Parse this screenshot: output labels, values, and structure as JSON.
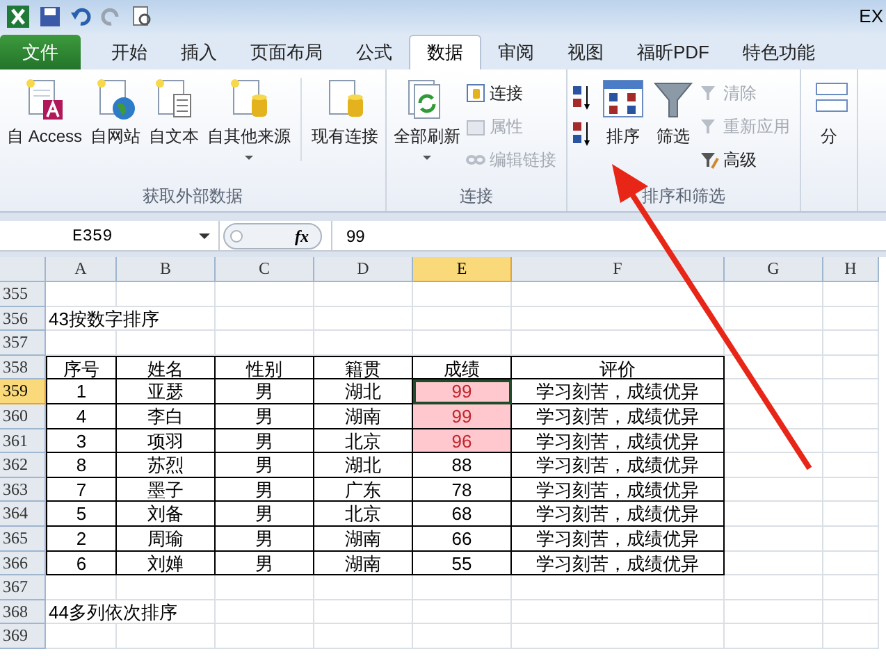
{
  "window": {
    "title": "EX"
  },
  "quick_access": [
    {
      "kind": "save"
    },
    {
      "kind": "undo"
    },
    {
      "kind": "redo"
    },
    {
      "kind": "preview"
    }
  ],
  "tabs": [
    {
      "label": "文件",
      "kind": "file",
      "selected": false
    },
    {
      "label": "开始",
      "kind": "tab",
      "selected": false
    },
    {
      "label": "插入",
      "kind": "tab",
      "selected": false
    },
    {
      "label": "页面布局",
      "kind": "tab",
      "selected": false
    },
    {
      "label": "公式",
      "kind": "tab",
      "selected": false
    },
    {
      "label": "数据",
      "kind": "tab",
      "selected": true
    },
    {
      "label": "审阅",
      "kind": "tab",
      "selected": false
    },
    {
      "label": "视图",
      "kind": "tab",
      "selected": false
    },
    {
      "label": "福昕PDF",
      "kind": "tab",
      "selected": false
    },
    {
      "label": "特色功能",
      "kind": "tab",
      "selected": false
    }
  ],
  "ribbon_groups": [
    {
      "label": "获取外部数据",
      "large": [
        {
          "label": "自 Access",
          "kind": "access",
          "dropdown": false
        },
        {
          "label": "自网站",
          "kind": "web",
          "dropdown": false
        },
        {
          "label": "自文本",
          "kind": "text",
          "dropdown": false
        },
        {
          "label": "自其他来源",
          "kind": "db",
          "dropdown": true
        },
        {
          "label": "现有连接",
          "kind": "existing",
          "dropdown": false
        }
      ]
    },
    {
      "label": "连接",
      "large": [
        {
          "label": "全部刷新",
          "kind": "refresh",
          "dropdown": true
        }
      ],
      "small": [
        {
          "label": "连接",
          "disabled": false
        },
        {
          "label": "属性",
          "disabled": true
        },
        {
          "label": "编辑链接",
          "disabled": true
        }
      ]
    },
    {
      "label": "排序和筛选",
      "large": [
        {
          "label": "排序",
          "kind": "sort",
          "dropdown": false
        },
        {
          "label": "筛选",
          "kind": "filter",
          "dropdown": false
        }
      ],
      "small": [
        {
          "label": "清除",
          "disabled": true
        },
        {
          "label": "重新应用",
          "disabled": true
        },
        {
          "label": "高级",
          "disabled": false
        }
      ]
    },
    {
      "large": [
        {
          "label": "分",
          "kind": "split",
          "dropdown": false
        }
      ]
    }
  ],
  "formula_bar": {
    "name_box": "E359",
    "function_label": "fx",
    "value": "99"
  },
  "columns": [
    {
      "label": "A",
      "selected": false
    },
    {
      "label": "B",
      "selected": false
    },
    {
      "label": "C",
      "selected": false
    },
    {
      "label": "D",
      "selected": false
    },
    {
      "label": "E",
      "selected": true
    },
    {
      "label": "F",
      "selected": false
    },
    {
      "label": "G",
      "selected": false
    },
    {
      "label": "H",
      "selected": false
    }
  ],
  "rows": [
    {
      "number": "355",
      "selected": false,
      "kind": "empty"
    },
    {
      "number": "356",
      "selected": false,
      "kind": "title",
      "text": "43按数字排序"
    },
    {
      "number": "357",
      "selected": false,
      "kind": "empty"
    },
    {
      "number": "358",
      "selected": false,
      "kind": "table",
      "cells": [
        "序号",
        "姓名",
        "性别",
        "籍贯",
        "成绩",
        "评价"
      ],
      "highlighted": false
    },
    {
      "number": "359",
      "selected": true,
      "kind": "table",
      "cells": [
        "1",
        "亚瑟",
        "男",
        "湖北",
        "99",
        "学习刻苦，成绩优异"
      ],
      "highlighted": true
    },
    {
      "number": "360",
      "selected": false,
      "kind": "table",
      "cells": [
        "4",
        "李白",
        "男",
        "湖南",
        "99",
        "学习刻苦，成绩优异"
      ],
      "highlighted": true
    },
    {
      "number": "361",
      "selected": false,
      "kind": "table",
      "cells": [
        "3",
        "项羽",
        "男",
        "北京",
        "96",
        "学习刻苦，成绩优异"
      ],
      "highlighted": true
    },
    {
      "number": "362",
      "selected": false,
      "kind": "table",
      "cells": [
        "8",
        "苏烈",
        "男",
        "湖北",
        "88",
        "学习刻苦，成绩优异"
      ],
      "highlighted": false
    },
    {
      "number": "363",
      "selected": false,
      "kind": "table",
      "cells": [
        "7",
        "墨子",
        "男",
        "广东",
        "78",
        "学习刻苦，成绩优异"
      ],
      "highlighted": false
    },
    {
      "number": "364",
      "selected": false,
      "kind": "table",
      "cells": [
        "5",
        "刘备",
        "男",
        "北京",
        "68",
        "学习刻苦，成绩优异"
      ],
      "highlighted": false
    },
    {
      "number": "365",
      "selected": false,
      "kind": "table",
      "cells": [
        "2",
        "周瑜",
        "男",
        "湖南",
        "66",
        "学习刻苦，成绩优异"
      ],
      "highlighted": false
    },
    {
      "number": "366",
      "selected": false,
      "kind": "table",
      "cells": [
        "6",
        "刘婵",
        "男",
        "湖南",
        "55",
        "学习刻苦，成绩优异"
      ],
      "highlighted": false
    },
    {
      "number": "367",
      "selected": false,
      "kind": "empty"
    },
    {
      "number": "368",
      "selected": false,
      "kind": "title",
      "text": "44多列依次排序"
    },
    {
      "number": "369",
      "selected": false,
      "kind": "empty"
    }
  ]
}
